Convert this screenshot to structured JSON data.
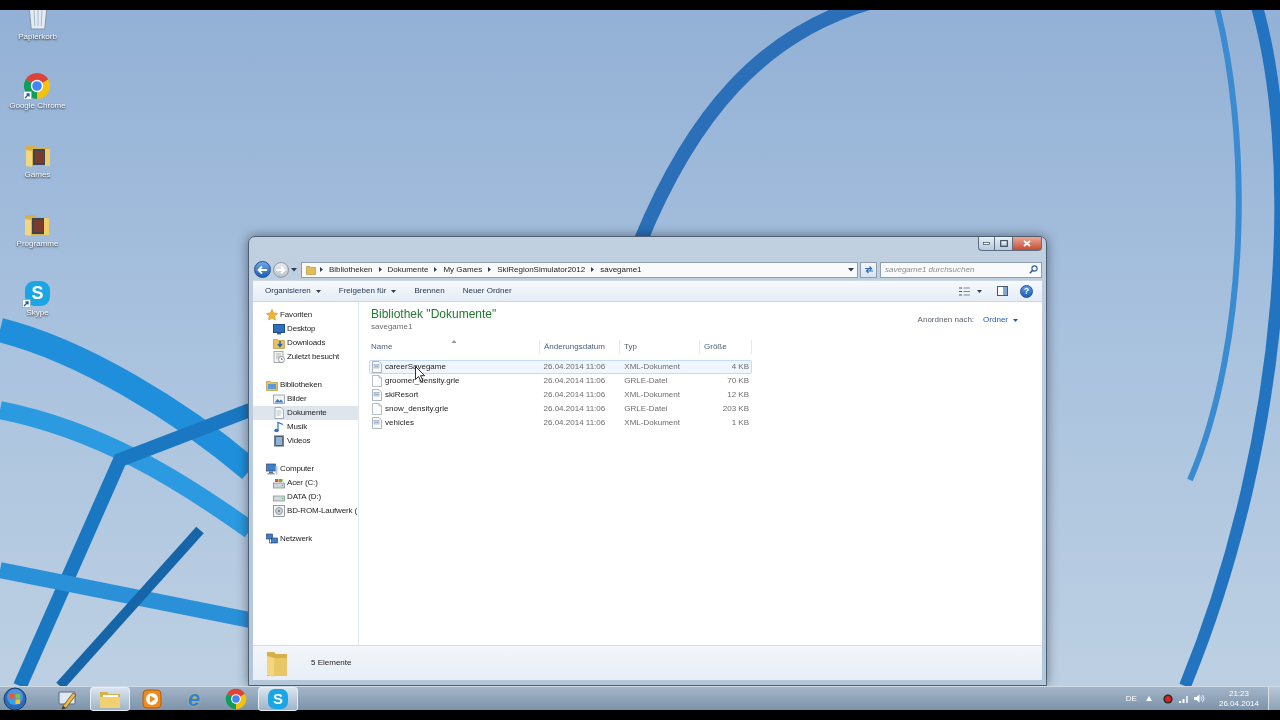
{
  "desktop": {
    "icons": [
      {
        "label": "Papierkorb",
        "kind": "recycle-bin"
      },
      {
        "label": "Google Chrome",
        "kind": "browser"
      },
      {
        "label": "Games",
        "kind": "folder"
      },
      {
        "label": "Programme",
        "kind": "folder"
      },
      {
        "label": "Skype",
        "kind": "skype",
        "logo": "S"
      }
    ]
  },
  "explorer": {
    "history": [
      {
        "kind": "back",
        "disabled": false
      },
      {
        "kind": "forward",
        "disabled": true
      }
    ],
    "address": {
      "crumbs": [
        "Bibliotheken",
        "Dokumente",
        "My Games",
        "SkiRegionSimulator2012",
        "savegame1"
      ]
    },
    "search": {
      "placeholder": "savegame1 durchsuchen"
    },
    "toolbar": {
      "buttons": [
        {
          "label": "Organisieren",
          "dropdown": true
        },
        {
          "label": "Freigeben für",
          "dropdown": true
        },
        {
          "label": "Brennen",
          "dropdown": false
        },
        {
          "label": "Neuer Ordner",
          "dropdown": false
        }
      ],
      "help": "?"
    },
    "nav": [
      {
        "label": "Favoriten",
        "kind": "star",
        "selected": false,
        "children": [
          {
            "label": "Desktop",
            "kind": "desktop",
            "selected": false
          },
          {
            "label": "Downloads",
            "kind": "downloads",
            "selected": false
          },
          {
            "label": "Zuletzt besucht",
            "kind": "recent",
            "selected": false
          }
        ]
      },
      {
        "label": "Bibliotheken",
        "kind": "libraries",
        "selected": false,
        "children": [
          {
            "label": "Bilder",
            "kind": "pictures",
            "selected": false
          },
          {
            "label": "Dokumente",
            "kind": "documents",
            "selected": true
          },
          {
            "label": "Musik",
            "kind": "music",
            "selected": false
          },
          {
            "label": "Videos",
            "kind": "videos",
            "selected": false
          }
        ]
      },
      {
        "label": "Computer",
        "kind": "computer",
        "selected": false,
        "children": [
          {
            "label": "Acer (C:)",
            "kind": "system-drive",
            "selected": false
          },
          {
            "label": "DATA (D:)",
            "kind": "drive",
            "selected": false
          },
          {
            "label": "BD-ROM-Laufwerk (",
            "kind": "disc-drive",
            "selected": false
          }
        ]
      },
      {
        "label": "Netzwerk",
        "kind": "network",
        "selected": false
      }
    ],
    "library": {
      "title": "Bibliothek \"Dokumente\"",
      "subtitle": "savegame1",
      "arrange_label": "Anordnen nach:",
      "arrange_value": "Ordner"
    },
    "table": {
      "columns": [
        {
          "label": "Name",
          "sorted": true
        },
        {
          "label": "Änderungsdatum",
          "sorted": false
        },
        {
          "label": "Typ",
          "sorted": false
        },
        {
          "label": "Größe",
          "sorted": false
        }
      ],
      "rows": [
        {
          "kind": "xml",
          "cells": [
            "careerSavegame",
            "26.04.2014 11:06",
            "XML-Dokument",
            "4 KB"
          ],
          "hovered": true,
          "selected": false
        },
        {
          "kind": "file",
          "cells": [
            "groomer_density.grle",
            "26.04.2014 11:06",
            "GRLE-Datei",
            "70 KB"
          ],
          "hovered": false,
          "selected": false
        },
        {
          "kind": "xml",
          "cells": [
            "skiResort",
            "26.04.2014 11:06",
            "XML-Dokument",
            "12 KB"
          ],
          "hovered": false,
          "selected": false
        },
        {
          "kind": "file",
          "cells": [
            "snow_density.grle",
            "26.04.2014 11:06",
            "GRLE-Datei",
            "203 KB"
          ],
          "hovered": false,
          "selected": false
        },
        {
          "kind": "xml",
          "cells": [
            "vehicles",
            "26.04.2014 11:06",
            "XML-Dokument",
            "1 KB"
          ],
          "hovered": false,
          "selected": false
        }
      ]
    },
    "status_bar": {
      "text": "5 Elemente"
    }
  },
  "taskbar": {
    "apps": [
      {
        "kind": "pencil",
        "active": false
      },
      {
        "kind": "explorer",
        "active": true
      },
      {
        "kind": "media",
        "active": false
      },
      {
        "kind": "ie",
        "active": false,
        "logo": "e"
      },
      {
        "kind": "browser",
        "active": false
      },
      {
        "kind": "skype",
        "active": true,
        "logo": "S"
      }
    ],
    "language": "DE",
    "time": "21:23",
    "date": "26.04.2014"
  }
}
